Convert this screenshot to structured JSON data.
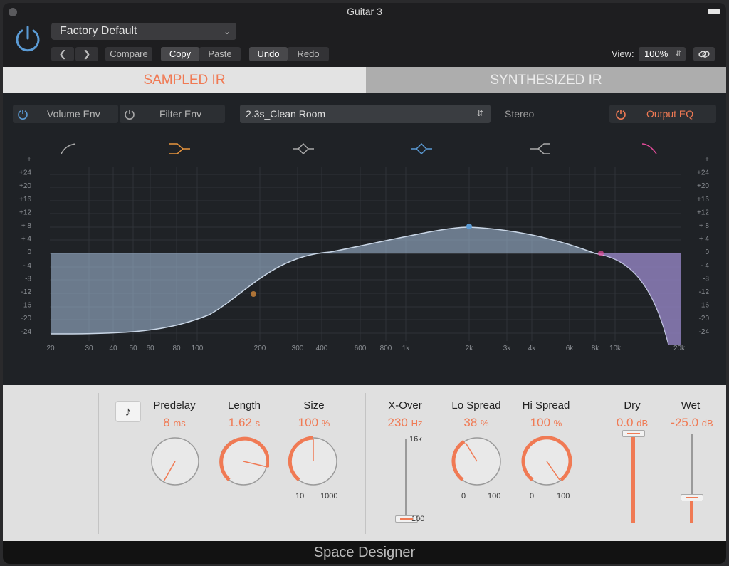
{
  "window": {
    "title": "Guitar 3"
  },
  "header": {
    "preset": "Factory Default",
    "compare_label": "Compare",
    "copy_label": "Copy",
    "paste_label": "Paste",
    "undo_label": "Undo",
    "redo_label": "Redo",
    "view_label": "View:",
    "view_zoom": "100%"
  },
  "tabs": {
    "sampled": "SAMPLED IR",
    "synthesized": "SYNTHESIZED IR",
    "active": "sampled"
  },
  "eq_bar": {
    "volume_env": "Volume Env",
    "filter_env": "Filter Env",
    "ir_name": "2.3s_Clean Room",
    "stereo": "Stereo",
    "output_eq": "Output EQ"
  },
  "eq_axis": {
    "y_labels": [
      "+",
      "+24",
      "+20",
      "+16",
      "+12",
      "+ 8",
      "+ 4",
      "0",
      "- 4",
      "-8",
      "-12",
      "-16",
      "-20",
      "-24",
      "-"
    ],
    "x_labels": [
      "20",
      "30",
      "40",
      "50",
      "60",
      "80",
      "100",
      "200",
      "300",
      "400",
      "600",
      "800",
      "1k",
      "2k",
      "3k",
      "4k",
      "6k",
      "8k",
      "10k",
      "20k"
    ]
  },
  "eq_band_icons": [
    "low-cut-icon",
    "low-shelf-icon",
    "bell-icon",
    "bell-icon",
    "high-shelf-icon",
    "high-cut-icon"
  ],
  "params": {
    "predelay": {
      "label": "Predelay",
      "value": "8",
      "unit": "ms"
    },
    "length": {
      "label": "Length",
      "value": "1.62",
      "unit": "s"
    },
    "size": {
      "label": "Size",
      "value": "100",
      "unit": "%",
      "min": "10",
      "max": "1000"
    },
    "xover": {
      "label": "X-Over",
      "value": "230",
      "unit": "Hz",
      "max": "16k",
      "min": "100"
    },
    "lo_spread": {
      "label": "Lo Spread",
      "value": "38",
      "unit": "%",
      "min": "0",
      "max": "100"
    },
    "hi_spread": {
      "label": "Hi Spread",
      "value": "100",
      "unit": "%",
      "min": "0",
      "max": "100"
    },
    "dry": {
      "label": "Dry",
      "value": "0.0",
      "unit": "dB"
    },
    "wet": {
      "label": "Wet",
      "value": "-25.0",
      "unit": "dB"
    }
  },
  "footer": {
    "plugin_name": "Space Designer"
  },
  "colors": {
    "accent": "#f07a54",
    "blue": "#5b9bd5"
  }
}
